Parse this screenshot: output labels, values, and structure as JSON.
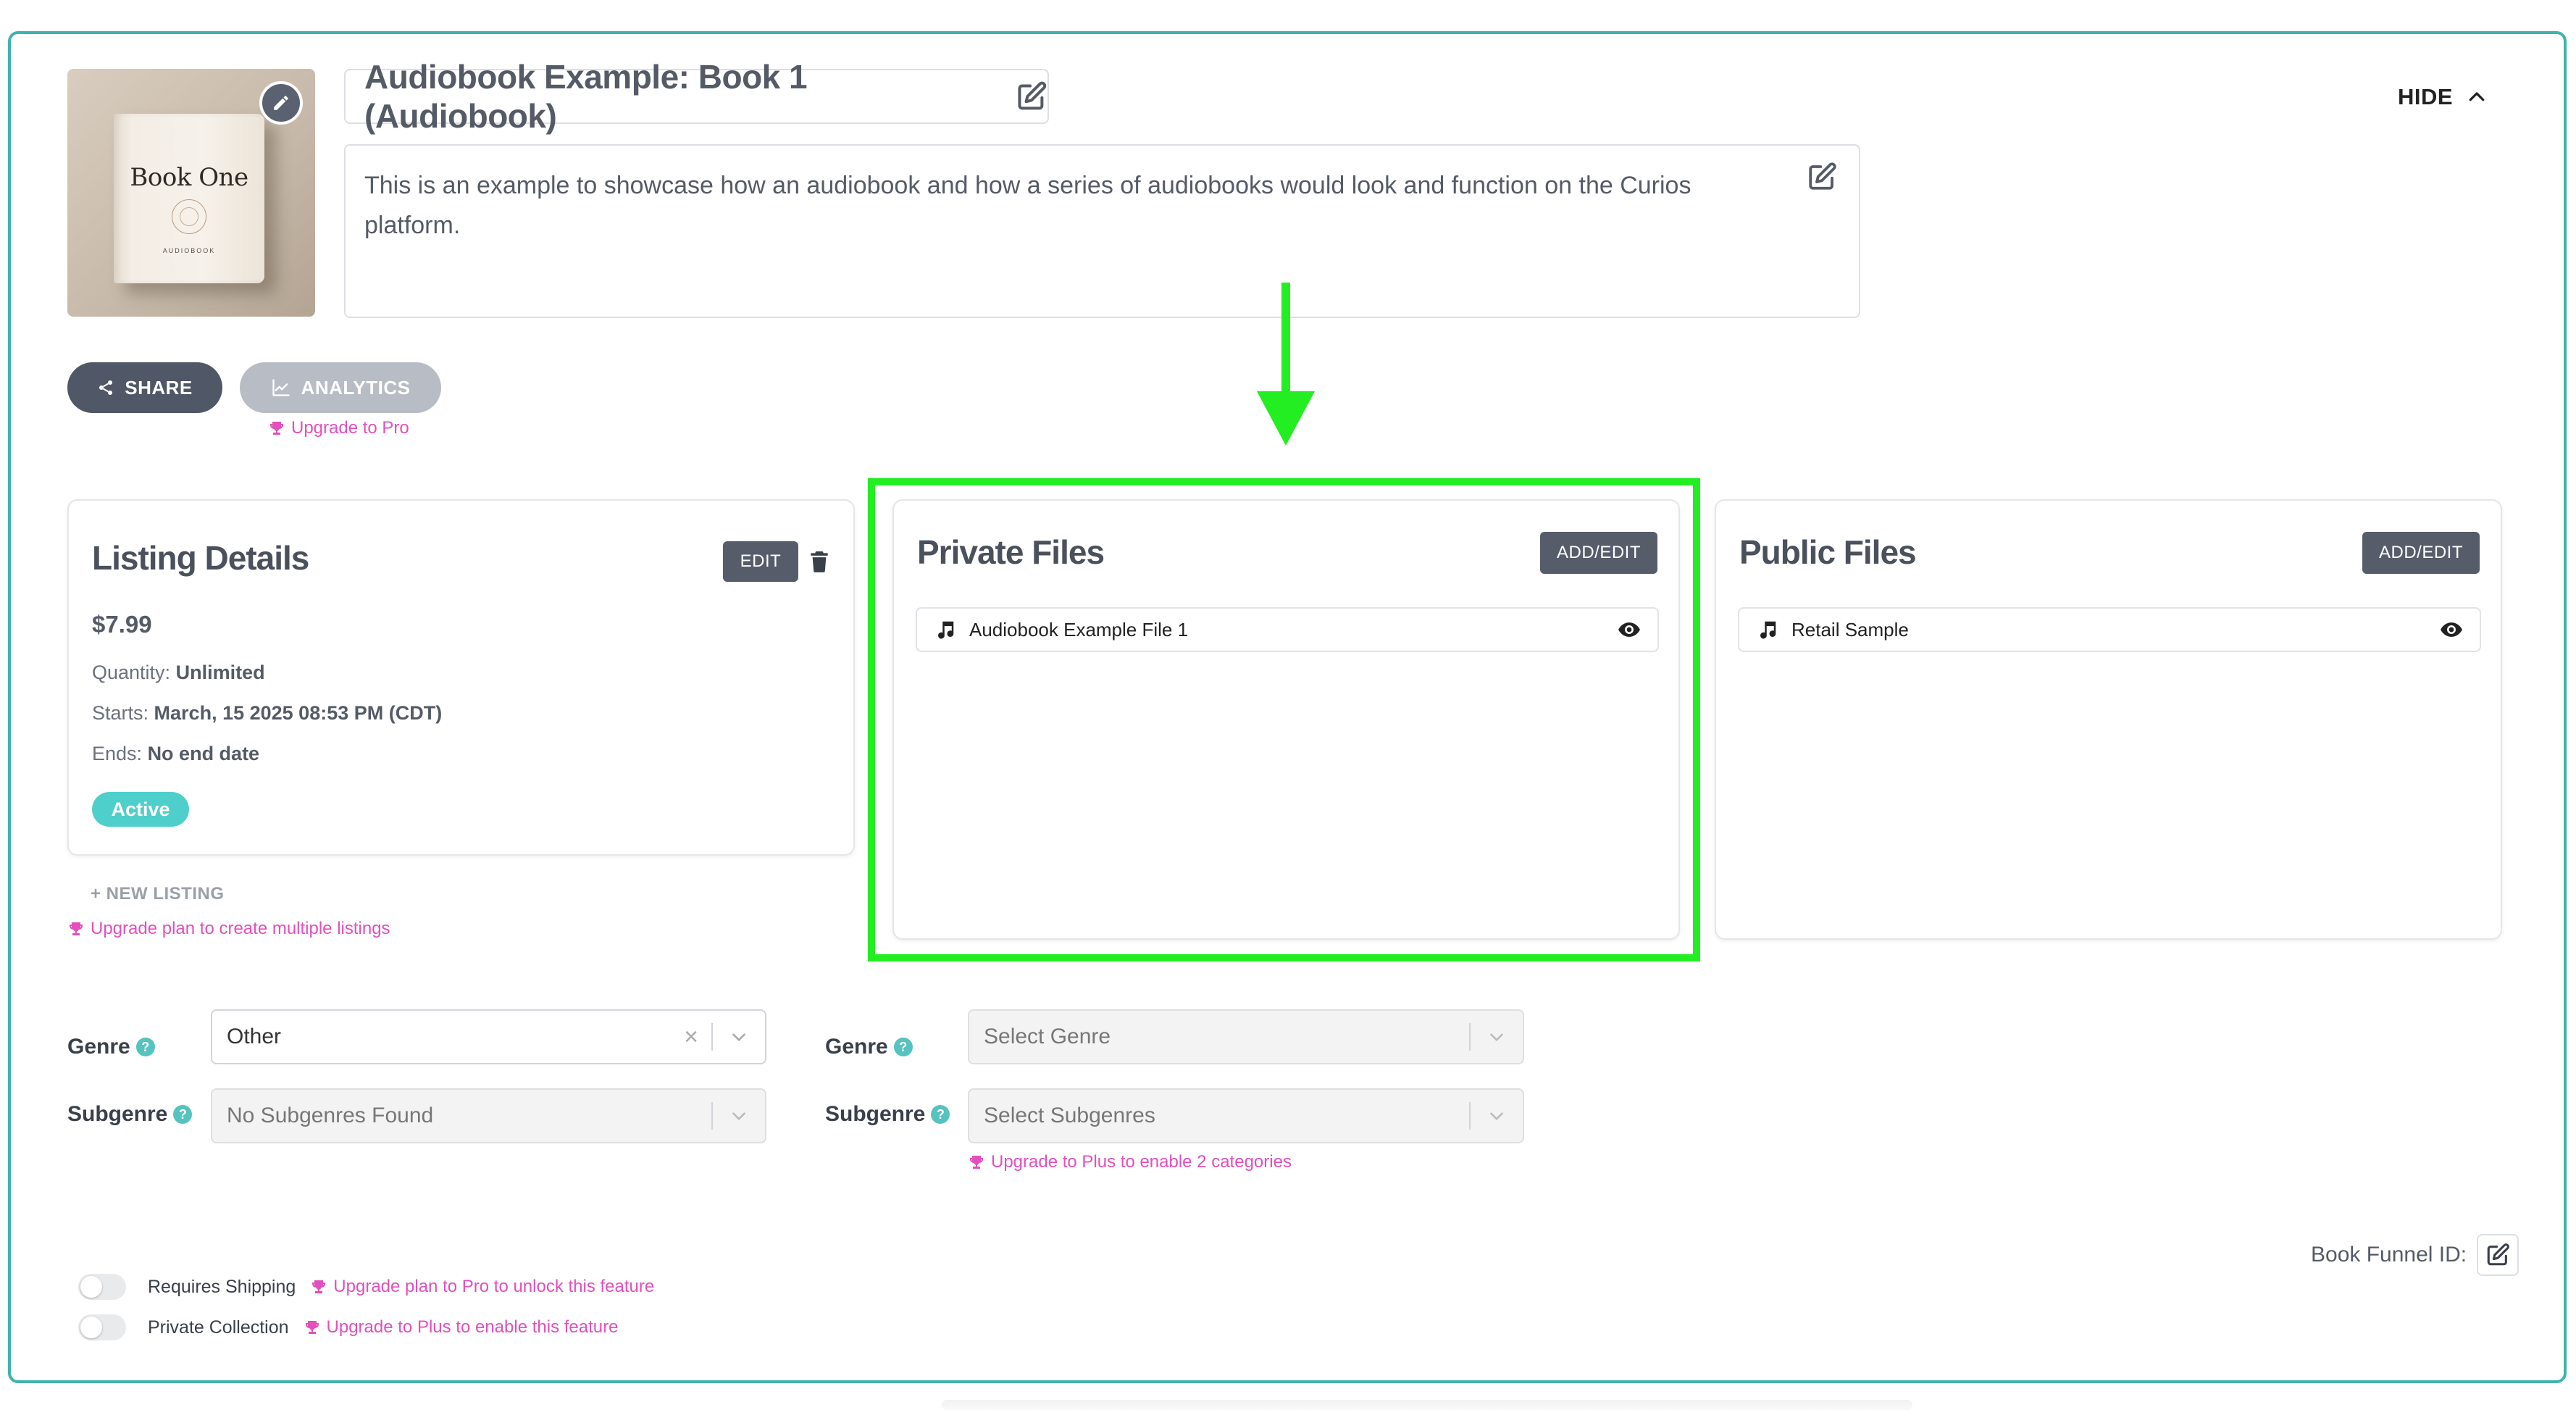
{
  "book": {
    "cover_title": "Book One",
    "cover_subtitle": "AUDIOBOOK",
    "title": "Audiobook Example: Book 1 (Audiobook)",
    "description": "This is an example to showcase how an audiobook and how a series of audiobooks would look and function on the Curios platform."
  },
  "header": {
    "hide_label": "HIDE"
  },
  "actions": {
    "share_label": "SHARE",
    "analytics_label": "ANALYTICS",
    "analytics_upgrade": "Upgrade to Pro"
  },
  "listing": {
    "title": "Listing Details",
    "edit_label": "EDIT",
    "price": "$7.99",
    "quantity_label": "Quantity:",
    "quantity_value": "Unlimited",
    "starts_label": "Starts:",
    "starts_value": "March, 15 2025 08:53 PM (CDT)",
    "ends_label": "Ends:",
    "ends_value": "No end date",
    "status": "Active",
    "new_listing": "+ NEW LISTING",
    "upgrade_listings": "Upgrade plan to create multiple listings"
  },
  "private_files": {
    "title": "Private Files",
    "button": "ADD/EDIT",
    "files": [
      {
        "name": "Audiobook Example File 1"
      }
    ]
  },
  "public_files": {
    "title": "Public Files",
    "button": "ADD/EDIT",
    "files": [
      {
        "name": "Retail Sample"
      }
    ]
  },
  "categories": {
    "primary": {
      "genre_label": "Genre",
      "genre_value": "Other",
      "subgenre_label": "Subgenre",
      "subgenre_value": "No Subgenres Found"
    },
    "secondary": {
      "genre_label": "Genre",
      "genre_placeholder": "Select Genre",
      "subgenre_label": "Subgenre",
      "subgenre_placeholder": "Select Subgenres",
      "upgrade": "Upgrade to Plus to enable 2 categories"
    }
  },
  "settings": {
    "funnel_label": "Book Funnel ID:",
    "requires_shipping_label": "Requires Shipping",
    "requires_shipping_upgrade": "Upgrade plan to Pro to unlock this feature",
    "requires_shipping_on": false,
    "private_collection_label": "Private Collection",
    "private_collection_upgrade": "Upgrade to Plus to enable this feature",
    "private_collection_on": false
  },
  "colors": {
    "frame_border": "#3fb3b0",
    "highlight": "#22ee22",
    "upgrade_pink": "#e34fbd",
    "active_badge": "#4fcfcb",
    "dark_button": "#565c69"
  },
  "icons": [
    "pencil-icon",
    "edit-square-icon",
    "chevron-up-icon",
    "share-icon",
    "chart-icon",
    "trophy-icon",
    "trash-icon",
    "music-note-icon",
    "eye-icon",
    "help-icon",
    "clear-icon",
    "chevron-down-icon",
    "down-arrow-icon"
  ]
}
